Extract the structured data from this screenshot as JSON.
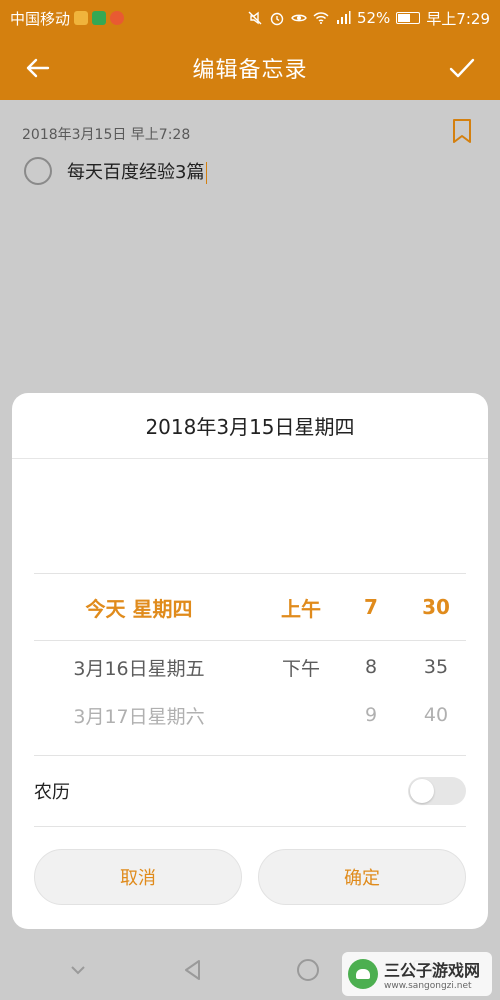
{
  "status": {
    "carrier": "中国移动",
    "battery": "52%",
    "time": "早上7:29"
  },
  "appbar": {
    "title": "编辑备忘录"
  },
  "note": {
    "date": "2018年3月15日 早上7:28",
    "text": "每天百度经验3篇"
  },
  "picker": {
    "header": "2018年3月15日星期四",
    "selected": {
      "date": "今天 星期四",
      "ampm": "上午",
      "hour": "7",
      "minute": "30"
    },
    "next": {
      "date": "3月16日星期五",
      "ampm": "下午",
      "hour": "8",
      "minute": "35"
    },
    "far": {
      "date": "3月17日星期六",
      "ampm": "",
      "hour": "9",
      "minute": "40"
    }
  },
  "lunar": {
    "label": "农历",
    "enabled": false
  },
  "buttons": {
    "cancel": "取消",
    "ok": "确定"
  },
  "watermark": {
    "name": "三公子游戏网",
    "url": "www.sangongzi.net"
  },
  "colors": {
    "accent": "#d4800f",
    "picker_selected": "#e08b1c"
  }
}
